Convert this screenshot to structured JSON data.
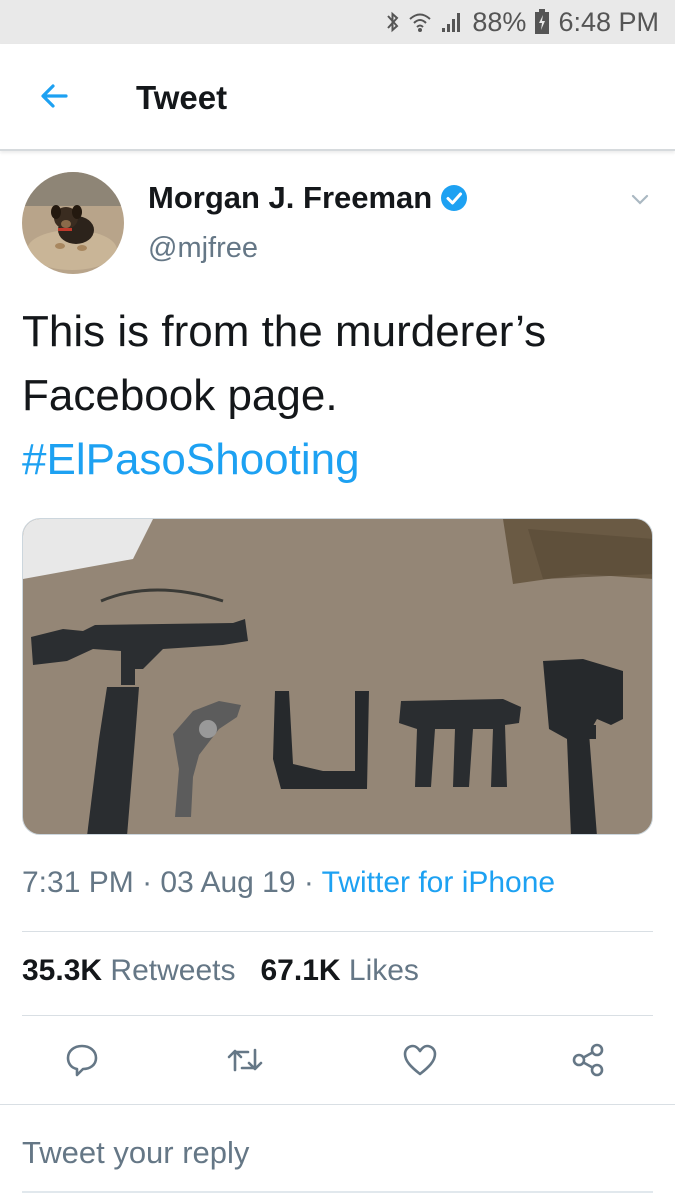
{
  "status_bar": {
    "battery": "88%",
    "time": "6:48 PM",
    "icons": [
      "bluetooth-icon",
      "wifi-icon",
      "signal-icon",
      "battery-charging-icon"
    ]
  },
  "header": {
    "title": "Tweet"
  },
  "tweet": {
    "author_name": "Morgan J. Freeman",
    "author_handle": "@mjfree",
    "text_line1": "This is from the murderer’s",
    "text_line2": "Facebook page.",
    "hashtag": "#ElPasoShooting",
    "time": "7:31 PM",
    "date": "03 Aug 19",
    "source": "Twitter for iPhone",
    "separator": " · ",
    "retweets_count": "35.3K",
    "retweets_label": "Retweets",
    "likes_count": "67.1K",
    "likes_label": "Likes"
  },
  "reply": {
    "placeholder": "Tweet your reply"
  },
  "colors": {
    "accent": "#1da1f2",
    "text": "#14171a",
    "muted": "#657786"
  }
}
